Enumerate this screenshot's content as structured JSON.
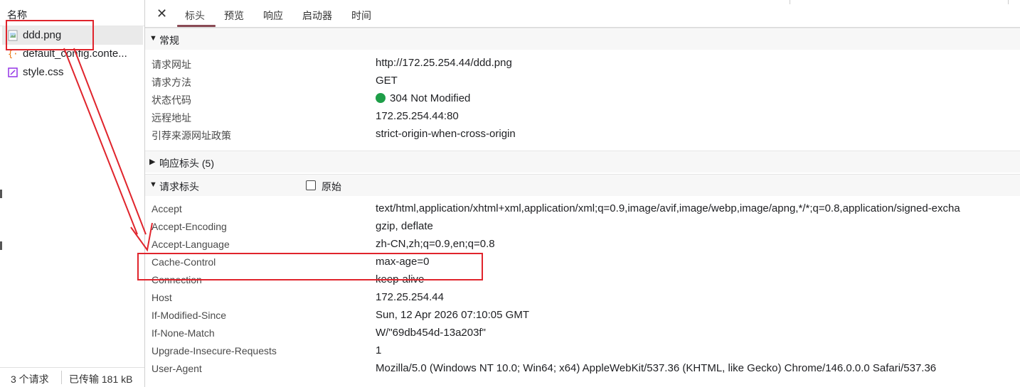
{
  "left": {
    "name_header": "名称",
    "files": [
      {
        "name": "ddd.png",
        "icon": "image-file-icon",
        "selected": true
      },
      {
        "name": "default_config.conte...",
        "icon": "script-file-icon",
        "selected": false
      },
      {
        "name": "style.css",
        "icon": "stylesheet-file-icon",
        "selected": false
      }
    ],
    "footer": {
      "requests": "3 个请求",
      "transferred": "已传输 181 kB"
    }
  },
  "tabs": {
    "close": "✕",
    "items": [
      "标头",
      "预览",
      "响应",
      "启动器",
      "时间"
    ],
    "active": "标头"
  },
  "general": {
    "title": "常规",
    "rows": [
      {
        "key": "请求网址",
        "value": "http://172.25.254.44/ddd.png"
      },
      {
        "key": "请求方法",
        "value": "GET"
      },
      {
        "key": "状态代码",
        "value": "304 Not Modified"
      },
      {
        "key": "远程地址",
        "value": "172.25.254.44:80"
      },
      {
        "key": "引荐来源网址政策",
        "value": "strict-origin-when-cross-origin"
      }
    ],
    "status_color": "#1e9e48"
  },
  "response_headers": {
    "title": "响应标头 (5)",
    "expanded": false
  },
  "request_headers": {
    "title": "请求标头",
    "raw_label": "原始",
    "raw_checked": false,
    "rows": [
      {
        "key": "Accept",
        "value": "text/html,application/xhtml+xml,application/xml;q=0.9,image/avif,image/webp,image/apng,*/*;q=0.8,application/signed-excha"
      },
      {
        "key": "Accept-Encoding",
        "value": "gzip, deflate"
      },
      {
        "key": "Accept-Language",
        "value": "zh-CN,zh;q=0.9,en;q=0.8"
      },
      {
        "key": "Cache-Control",
        "value": "max-age=0"
      },
      {
        "key": "Connection",
        "value": "keep-alive"
      },
      {
        "key": "Host",
        "value": "172.25.254.44"
      },
      {
        "key": "If-Modified-Since",
        "value": "Sun, 12 Apr 2026 07:10:05 GMT"
      },
      {
        "key": "If-None-Match",
        "value": "W/\"69db454d-13a203f\""
      },
      {
        "key": "Upgrade-Insecure-Requests",
        "value": "1"
      },
      {
        "key": "User-Agent",
        "value": "Mozilla/5.0 (Windows NT 10.0; Win64; x64) AppleWebKit/537.36 (KHTML, like Gecko) Chrome/146.0.0.0 Safari/537.36"
      }
    ]
  },
  "colors": {
    "annotation": "#e0242c",
    "tab_underline": "#8a4a55"
  }
}
